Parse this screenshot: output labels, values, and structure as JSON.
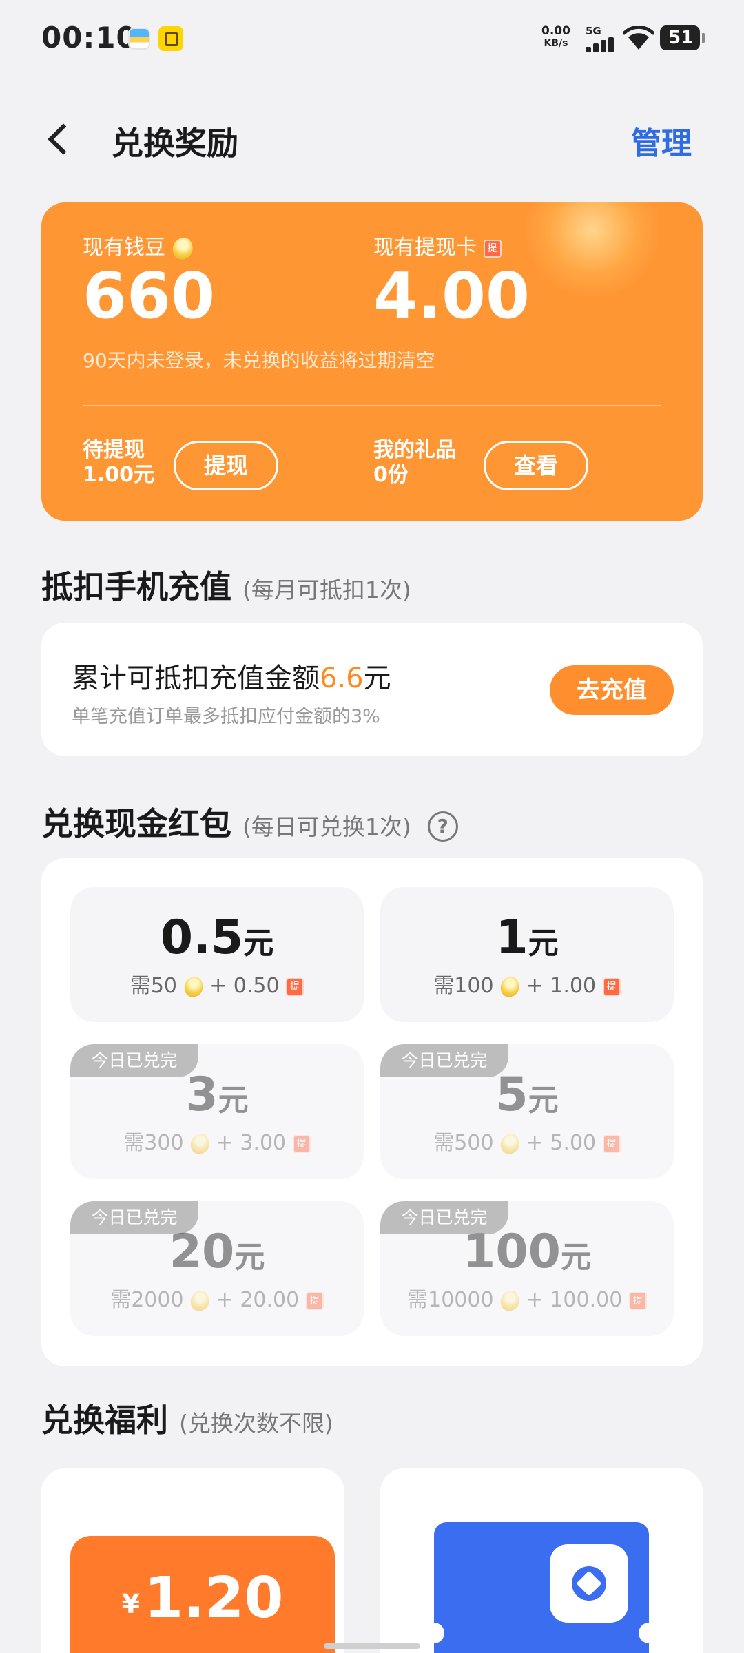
{
  "status_bar": {
    "time": "00:10",
    "net_speed_value": "0.00",
    "net_speed_unit": "KB/s",
    "network_type": "5G",
    "battery": "51"
  },
  "header": {
    "title": "兑换奖励",
    "manage_label": "管理"
  },
  "balance": {
    "beans_label": "现有钱豆",
    "beans_value": "660",
    "cards_label": "现有提现卡",
    "cards_icon_text": "提",
    "cards_value": "4.00",
    "expiry_note": "90天内未登录，未兑换的收益将过期清空",
    "pending_label": "待提现",
    "pending_value": "1.00元",
    "withdraw_label": "提现",
    "gifts_label": "我的礼品",
    "gifts_value": "0份",
    "view_label": "查看"
  },
  "recharge": {
    "title": "抵扣手机充值",
    "subtitle": "(每月可抵扣1次)",
    "main_prefix": "累计可抵扣充值金额",
    "amount": "6.6",
    "main_suffix": "元",
    "note": "单笔充值订单最多抵扣应付金额的3%",
    "button_label": "去充值"
  },
  "cash": {
    "title": "兑换现金红包",
    "subtitle": "(每日可兑换1次)",
    "help_icon": "?",
    "unit": "元",
    "done_label": "今日已兑完",
    "card_icon_text": "提",
    "tiles": [
      {
        "amount": "0.5",
        "beans": "需50",
        "cards": "+ 0.50",
        "done": false
      },
      {
        "amount": "1",
        "beans": "需100",
        "cards": "+ 1.00",
        "done": false
      },
      {
        "amount": "3",
        "beans": "需300",
        "cards": "+ 3.00",
        "done": true
      },
      {
        "amount": "5",
        "beans": "需500",
        "cards": "+ 5.00",
        "done": true
      },
      {
        "amount": "20",
        "beans": "需2000",
        "cards": "+ 20.00",
        "done": true
      },
      {
        "amount": "100",
        "beans": "需10000",
        "cards": "+ 100.00",
        "done": true
      }
    ]
  },
  "welfare": {
    "title": "兑换福利",
    "subtitle": "(兑换次数不限)",
    "coupon_currency": "¥",
    "coupon_price": "1.20"
  },
  "colors": {
    "accent_orange": "#ff9634",
    "link_blue": "#2f6be3",
    "coupon_blue": "#3a6df0"
  }
}
